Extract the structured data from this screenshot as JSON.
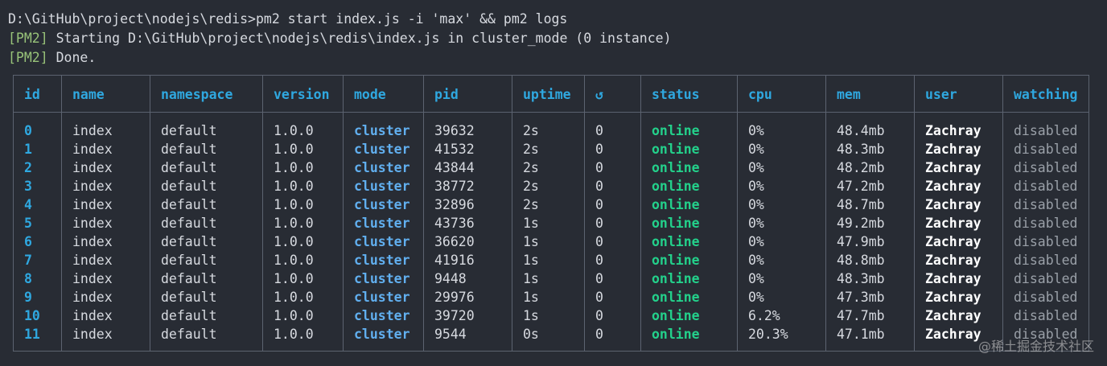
{
  "terminal": {
    "command_line": "D:\\GitHub\\project\\nodejs\\redis>pm2 start index.js -i 'max' && pm2 logs",
    "pm2_tag": "[PM2]",
    "starting_text": " Starting D:\\GitHub\\project\\nodejs\\redis\\index.js in cluster_mode (0 instance)",
    "done_text": " Done."
  },
  "table": {
    "headers": [
      "id",
      "name",
      "namespace",
      "version",
      "mode",
      "pid",
      "uptime",
      "↺",
      "status",
      "cpu",
      "mem",
      "user",
      "watching"
    ],
    "rows": [
      [
        "0",
        "index",
        "default",
        "1.0.0",
        "cluster",
        "39632",
        "2s",
        "0",
        "online",
        "0%",
        "48.4mb",
        "Zachray",
        "disabled"
      ],
      [
        "1",
        "index",
        "default",
        "1.0.0",
        "cluster",
        "41532",
        "2s",
        "0",
        "online",
        "0%",
        "48.3mb",
        "Zachray",
        "disabled"
      ],
      [
        "2",
        "index",
        "default",
        "1.0.0",
        "cluster",
        "43844",
        "2s",
        "0",
        "online",
        "0%",
        "48.2mb",
        "Zachray",
        "disabled"
      ],
      [
        "3",
        "index",
        "default",
        "1.0.0",
        "cluster",
        "38772",
        "2s",
        "0",
        "online",
        "0%",
        "47.2mb",
        "Zachray",
        "disabled"
      ],
      [
        "4",
        "index",
        "default",
        "1.0.0",
        "cluster",
        "32896",
        "2s",
        "0",
        "online",
        "0%",
        "48.7mb",
        "Zachray",
        "disabled"
      ],
      [
        "5",
        "index",
        "default",
        "1.0.0",
        "cluster",
        "43736",
        "1s",
        "0",
        "online",
        "0%",
        "49.2mb",
        "Zachray",
        "disabled"
      ],
      [
        "6",
        "index",
        "default",
        "1.0.0",
        "cluster",
        "36620",
        "1s",
        "0",
        "online",
        "0%",
        "47.9mb",
        "Zachray",
        "disabled"
      ],
      [
        "7",
        "index",
        "default",
        "1.0.0",
        "cluster",
        "41916",
        "1s",
        "0",
        "online",
        "0%",
        "48.8mb",
        "Zachray",
        "disabled"
      ],
      [
        "8",
        "index",
        "default",
        "1.0.0",
        "cluster",
        "9448",
        "1s",
        "0",
        "online",
        "0%",
        "48.3mb",
        "Zachray",
        "disabled"
      ],
      [
        "9",
        "index",
        "default",
        "1.0.0",
        "cluster",
        "29976",
        "1s",
        "0",
        "online",
        "0%",
        "47.3mb",
        "Zachray",
        "disabled"
      ],
      [
        "10",
        "index",
        "default",
        "1.0.0",
        "cluster",
        "39720",
        "1s",
        "0",
        "online",
        "6.2%",
        "47.7mb",
        "Zachray",
        "disabled"
      ],
      [
        "11",
        "index",
        "default",
        "1.0.0",
        "cluster",
        "9544",
        "0s",
        "0",
        "online",
        "20.3%",
        "47.1mb",
        "Zachray",
        "disabled"
      ]
    ]
  },
  "watermark": "@稀土掘金技术社区",
  "colors": {
    "background": "#282c34",
    "header": "#2fa8e0",
    "pm2_tag": "#98c379",
    "status_online": "#23d18b",
    "mode_cluster": "#61afef",
    "border": "#5c6370"
  }
}
